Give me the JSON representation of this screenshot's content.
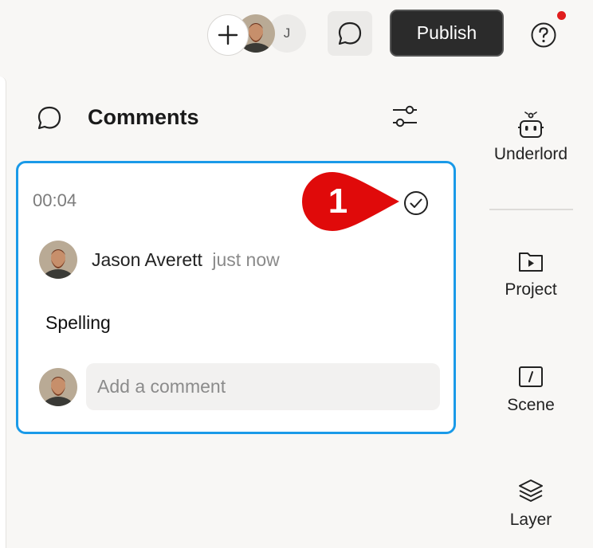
{
  "topbar": {
    "add_label": "+",
    "user_initial": "J",
    "publish_label": "Publish",
    "help_label": "?"
  },
  "comments": {
    "title": "Comments",
    "card": {
      "timestamp": "00:04",
      "author": "Jason Averett",
      "time_ago": "just now",
      "text": "Spelling",
      "reply_placeholder": "Add a comment"
    }
  },
  "annotation": {
    "step": "1"
  },
  "rail": {
    "items": [
      {
        "label": "Underlord",
        "icon": "robot-icon"
      },
      {
        "label": "Project",
        "icon": "folder-play-icon"
      },
      {
        "label": "Scene",
        "icon": "scene-icon"
      },
      {
        "label": "Layer",
        "icon": "layers-icon"
      }
    ]
  },
  "colors": {
    "accent": "#1a9ae8",
    "annotation": "#e00a0a",
    "publish_bg": "#2b2b2b",
    "notification": "#e01d1d"
  }
}
